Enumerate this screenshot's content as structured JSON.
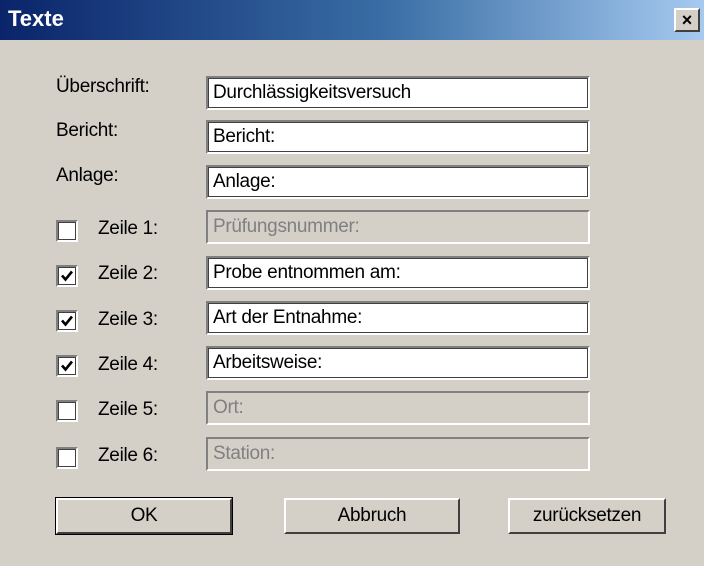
{
  "window": {
    "title": "Texte",
    "close_symbol": "×"
  },
  "fields": {
    "ueberschrift": {
      "label": "Überschrift:",
      "value": "Durchlässigkeitsversuch"
    },
    "bericht": {
      "label": "Bericht:",
      "value": "Bericht:"
    },
    "anlage": {
      "label": "Anlage:",
      "value": "Anlage:"
    }
  },
  "lines": [
    {
      "label": "Zeile 1:",
      "value": "Prüfungsnummer:",
      "checked": false
    },
    {
      "label": "Zeile 2:",
      "value": "Probe entnommen am:",
      "checked": true
    },
    {
      "label": "Zeile 3:",
      "value": "Art der Entnahme:",
      "checked": true
    },
    {
      "label": "Zeile 4:",
      "value": "Arbeitsweise:",
      "checked": true
    },
    {
      "label": "Zeile 5:",
      "value": "Ort:",
      "checked": false
    },
    {
      "label": "Zeile 6:",
      "value": "Station:",
      "checked": false
    }
  ],
  "buttons": {
    "ok": "OK",
    "cancel": "Abbruch",
    "reset": "zurücksetzen"
  }
}
